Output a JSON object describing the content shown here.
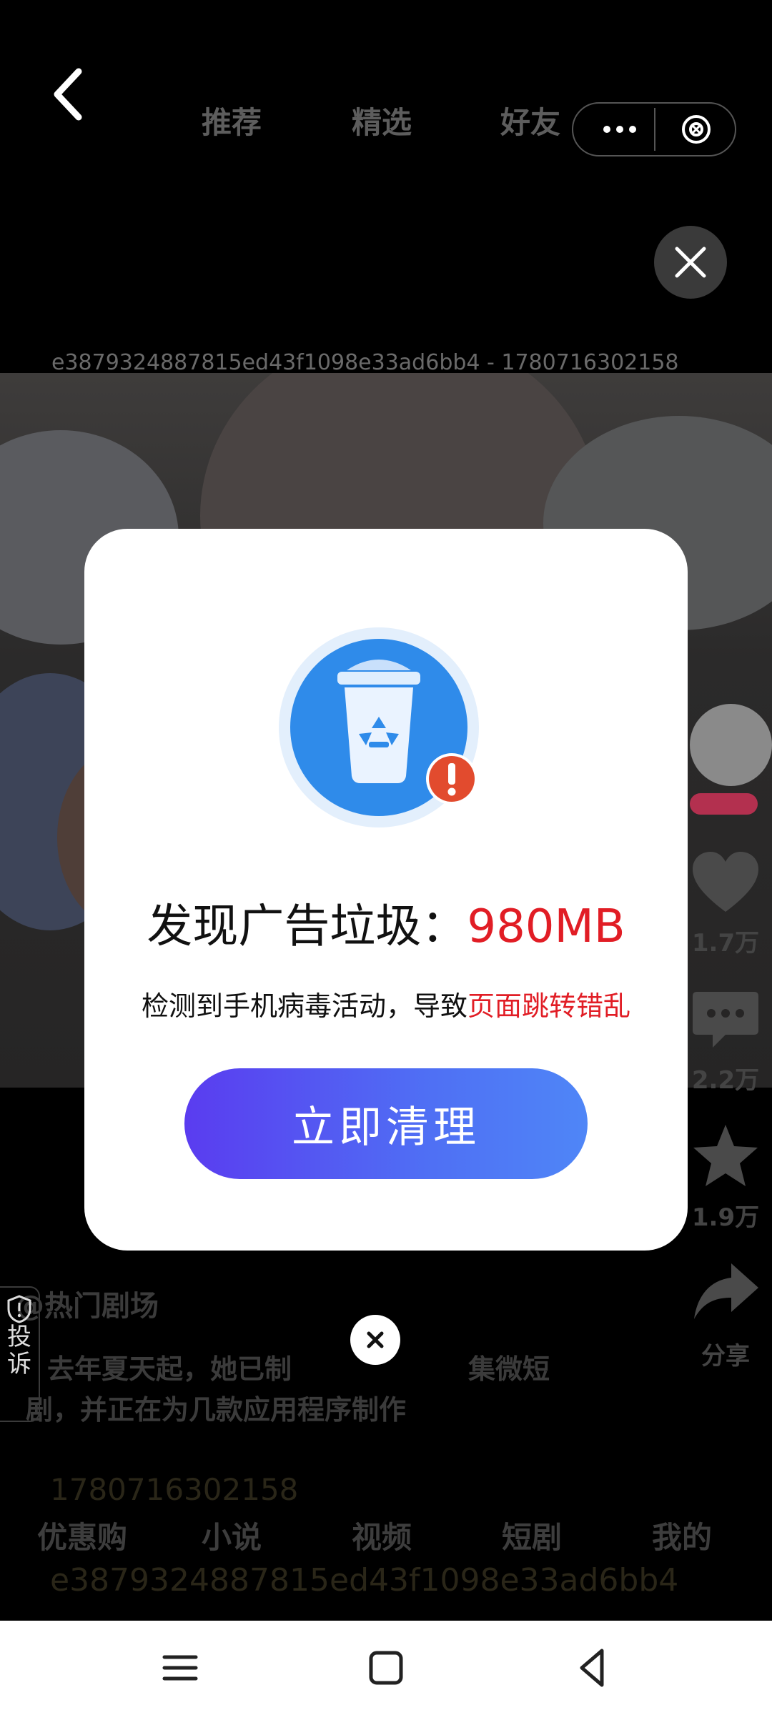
{
  "top_bar": {
    "tabs": [
      "推荐",
      "精选",
      "好友"
    ]
  },
  "watermark": {
    "id_text": "e3879324887815ed43f1098e33ad6bb4 - 1780716302158",
    "timestamp": "1780716302158",
    "id": "e3879324887815ed43f1098e33ad6bb4"
  },
  "side_actions": {
    "follow_label": "+",
    "like_count": "1.7万",
    "comment_count": "2.2万",
    "favorite_count": "1.9万",
    "share_label": "分享"
  },
  "caption": {
    "author": "@热门剧场",
    "line1": "去年夏天起，她已制",
    "line1_tail": "集微短",
    "line2": "剧，并正在为几款应用程序制作"
  },
  "complain": {
    "label_line1": "投",
    "label_line2": "诉"
  },
  "bottom_tabs": [
    "优惠购",
    "小说",
    "视频",
    "短剧",
    "我的"
  ],
  "dialog": {
    "headline_prefix": "发现广告垃圾：",
    "headline_value": "980MB",
    "sub_prefix": "检测到手机病毒活动，导致",
    "sub_highlight": "页面跳转错乱",
    "cta_label": "立即清理"
  },
  "colors": {
    "accent_red": "#e11d25",
    "cta_start": "#5a3cf0",
    "cta_end": "#4f86f7"
  },
  "icons": {
    "back": "chevron-left-icon",
    "more": "more-dots-icon",
    "close_mini_program": "close-circle-icon",
    "close_ad": "close-icon",
    "trash": "recycle-bin-icon",
    "alert": "exclamation-badge-icon",
    "like": "heart-icon",
    "comment": "comment-icon",
    "favorite": "star-icon",
    "share": "share-icon",
    "nav_menu": "menu-icon",
    "nav_home": "home-square-icon",
    "nav_back": "back-triangle-icon"
  }
}
